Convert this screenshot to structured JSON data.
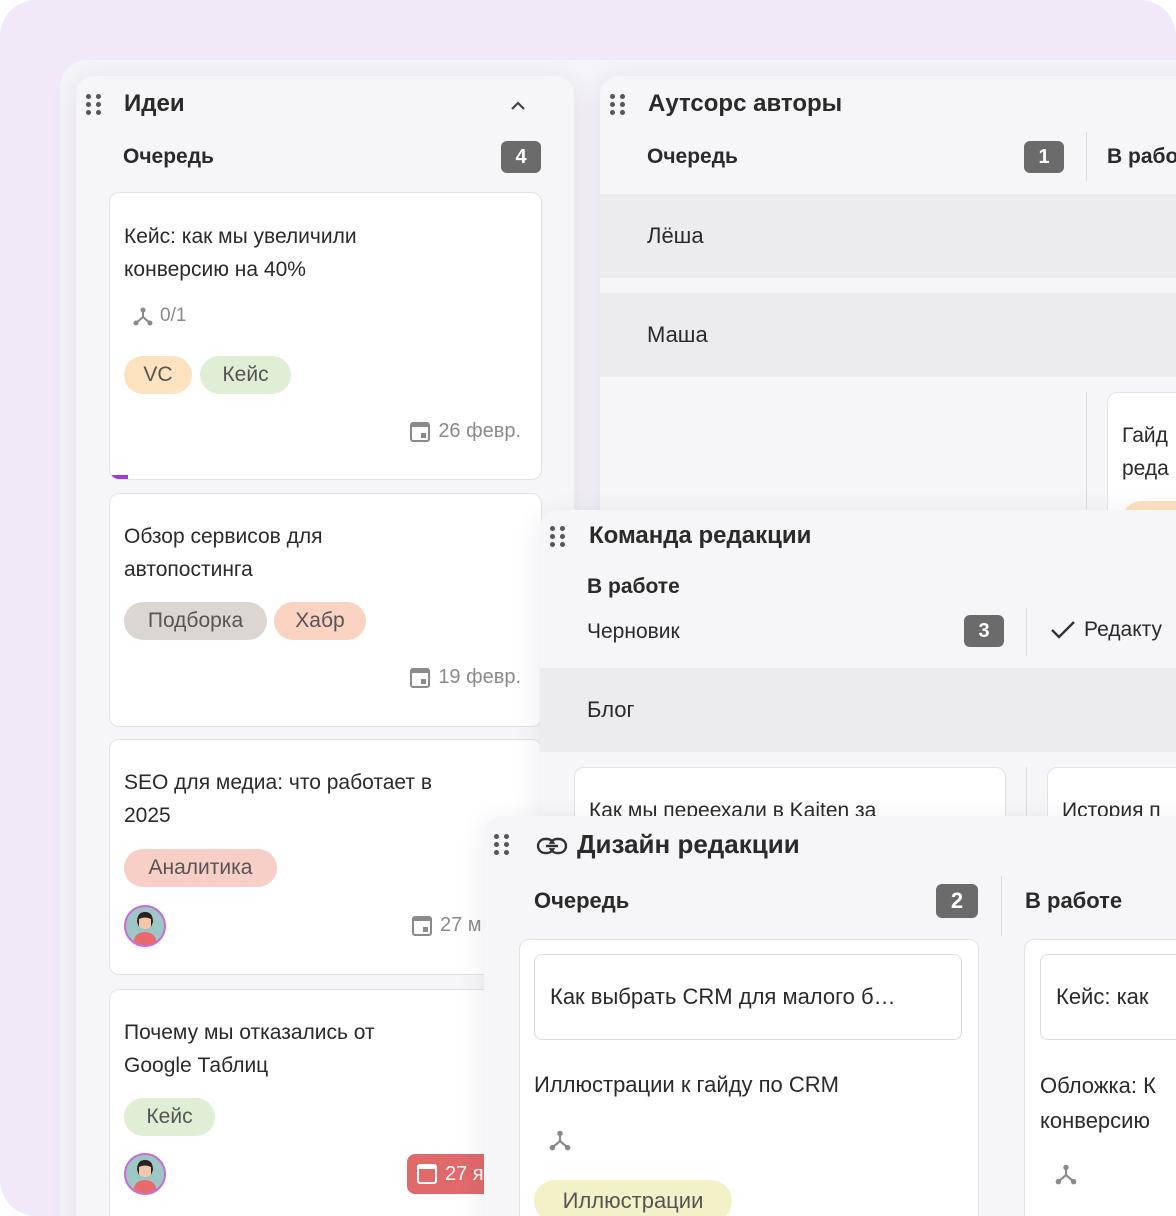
{
  "ideas": {
    "title": "Идеи",
    "column": "Очередь",
    "count": "4",
    "cards": [
      {
        "title": "Кейс: как мы увеличили конверсию на 40%",
        "subtasks": "0/1",
        "tags": [
          "VC",
          "Кейс"
        ],
        "date": "26 февр."
      },
      {
        "title": "Обзор сервисов для автопостинга",
        "tags": [
          "Подборка",
          "Хабр"
        ],
        "date": "19 февр."
      },
      {
        "title": "SEO для медиа: что работает в 2025",
        "tags": [
          "Аналитика"
        ],
        "date": "27 м"
      },
      {
        "title": "Почему мы отказались от Google Таблиц",
        "tags": [
          "Кейс"
        ],
        "date": "27 я"
      }
    ]
  },
  "outsource": {
    "title": "Аутсорс авторы",
    "column": "Очередь",
    "count": "1",
    "column2": "В рабо",
    "lanes": [
      "Лёша",
      "Маша"
    ],
    "card_partial": "Гайд реда"
  },
  "editorial": {
    "title": "Команда редакции",
    "group": "В работе",
    "column": "Черновик",
    "count": "3",
    "column2": "Редакту",
    "lane": "Блог",
    "card1": "Как мы переехали в Kaiten за",
    "card2": "История п"
  },
  "design": {
    "title": "Дизайн редакции",
    "column": "Очередь",
    "count": "2",
    "column2": "В работе",
    "card1_link": "Как выбрать CRM для малого б…",
    "card1_title": "Иллюстрации к гайду по CRM",
    "card1_tag": "Иллюстрации",
    "card2_link": "Кейс: как",
    "card2_title": "Обложка: К конверсию"
  },
  "colors": {
    "tag_vc": "#fde2c0",
    "tag_case": "#dfeed5",
    "tag_selection": "#dcd6d3",
    "tag_habr": "#fbd3c2",
    "tag_analytics": "#f8cfc6",
    "tag_illustrations": "#f3f1c7",
    "overdue": "#e06a6a"
  }
}
